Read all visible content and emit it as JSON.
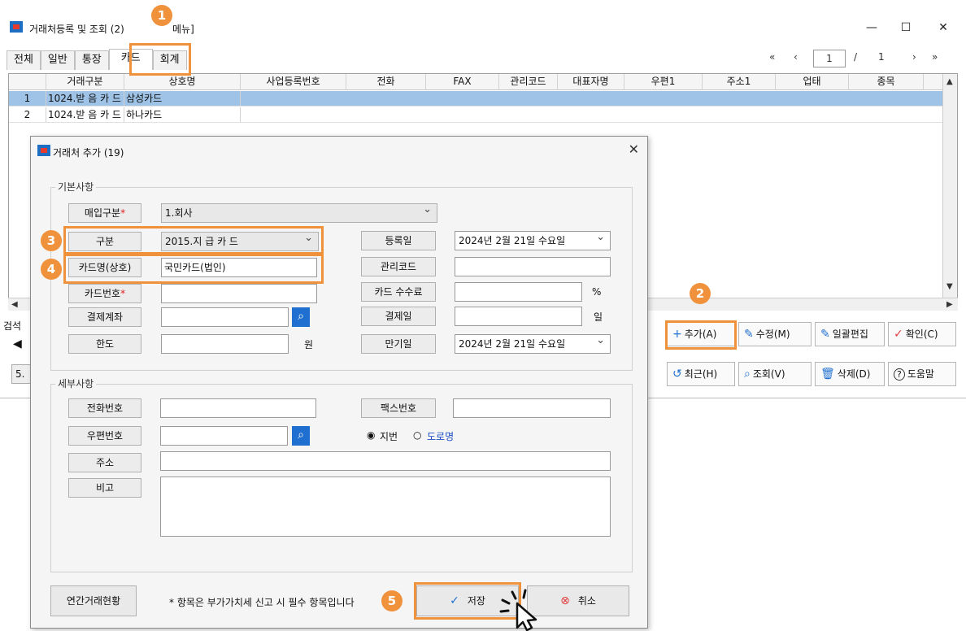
{
  "main_window": {
    "title": "거래처등록 및 조회 (2)",
    "title_suffix": "메뉴]",
    "controls": {
      "minimize": "—",
      "maximize": "☐",
      "close": "✕"
    },
    "tabs": [
      "전체",
      "일반",
      "통장",
      "카드",
      "회계"
    ],
    "active_tab": "카드",
    "pager": {
      "first": "«",
      "prev": "‹",
      "page": "1",
      "separator": "/",
      "total": "1",
      "next": "›",
      "last": "»"
    }
  },
  "grid": {
    "columns": [
      "거래구분",
      "상호명",
      "사업등록번호",
      "전화",
      "FAX",
      "관리코드",
      "대표자명",
      "우편1",
      "주소1",
      "업태",
      "종목"
    ],
    "rows": [
      {
        "num": "1",
        "type": "1024.받 음 카 드",
        "name": "삼성카드"
      },
      {
        "num": "2",
        "type": "1024.받 음 카 드",
        "name": "하나카드"
      }
    ]
  },
  "side_left": {
    "search_label": "검석",
    "arrow": "◀",
    "code": "5."
  },
  "side_buttons": [
    {
      "icon": "+",
      "label": "추가(A)"
    },
    {
      "icon": "✎",
      "label": "수정(M)"
    },
    {
      "icon": "✎",
      "label": "일괄편집"
    },
    {
      "icon": "✓",
      "label": "확인(C)"
    },
    {
      "icon": "↺",
      "label": "최근(H)"
    },
    {
      "icon": "⌕",
      "label": "조회(V)"
    },
    {
      "icon": "🗑",
      "label": "삭제(D)"
    },
    {
      "icon": "?",
      "label": "도움말"
    }
  ],
  "dialog": {
    "title": "거래처 추가 (19)",
    "close": "✕",
    "basic": {
      "legend": "기본사항",
      "purchase_type_label": "매입구분",
      "purchase_type_value": "1.회사",
      "category_label": "구분",
      "category_value": "2015.지 급 카 드",
      "card_name_label": "카드명(상호)",
      "card_name_value": "국민카드(법인)",
      "card_no_label": "카드번호",
      "account_label": "결제계좌",
      "limit_label": "한도",
      "limit_unit": "원",
      "reg_date_label": "등록일",
      "reg_date_value": "2024년  2월 21일 수요일",
      "mgmt_code_label": "관리코드",
      "fee_label": "카드 수수료",
      "fee_unit": "%",
      "pay_day_label": "결제일",
      "pay_day_unit": "일",
      "expire_label": "만기일",
      "expire_value": "2024년  2월 21일 수요일",
      "required_mark": "*"
    },
    "detail": {
      "legend": "세부사항",
      "phone_label": "전화번호",
      "fax_label": "팩스번호",
      "zip_label": "우편번호",
      "addr_type_jibun": "지번",
      "addr_type_road": "도로명",
      "address_label": "주소",
      "note_label": "비고"
    },
    "footer": {
      "annual_button": "연간거래현황",
      "note": "* 항목은 부가가치세 신고 시 필수 항목입니다",
      "save_button": "저장",
      "cancel_button": "취소"
    }
  },
  "steps": [
    "1",
    "2",
    "3",
    "4",
    "5"
  ],
  "colors": {
    "accent": "#f0913c",
    "selection": "#9ec3e6",
    "brand_blue": "#1e6fcf",
    "link_blue": "#1a4fc4"
  }
}
